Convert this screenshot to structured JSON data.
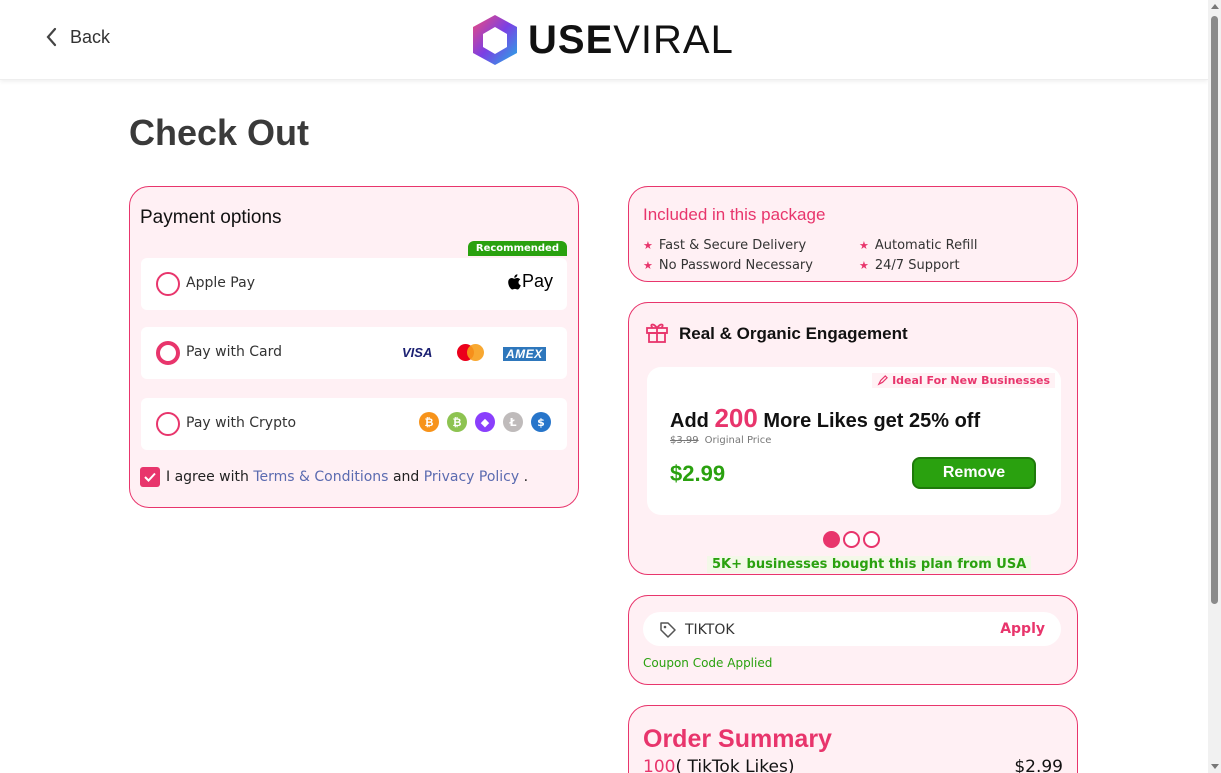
{
  "header": {
    "back_label": "Back",
    "logo_bold": "USE",
    "logo_light": "VIRAL"
  },
  "page_title": "Check Out",
  "payment": {
    "title": "Payment options",
    "recommended_badge": "Recommended",
    "options": [
      {
        "label": "Apple Pay",
        "selected": false,
        "brand": "Pay"
      },
      {
        "label": "Pay with Card",
        "selected": true,
        "brands": [
          "VISA",
          "AMEX"
        ]
      },
      {
        "label": "Pay with Crypto",
        "selected": false,
        "coins": [
          "bitcoin-icon",
          "bitcoin-cash-icon",
          "ethereum-icon",
          "litecoin-icon",
          "usdc-icon"
        ]
      }
    ],
    "agree_prefix": "I agree with",
    "terms_link": "Terms & Conditions",
    "agree_and": "and",
    "privacy_link": "Privacy Policy",
    "agree_suffix": ".",
    "agree_checked": true
  },
  "included": {
    "title": "Included in this package",
    "features": [
      "Fast & Secure Delivery",
      "Automatic Refill",
      "No Password Necessary",
      "24/7 Support"
    ]
  },
  "engagement": {
    "title": "Real & Organic Engagement",
    "ideal_tag": "Ideal For New Businesses",
    "add_prefix": "Add",
    "add_count": "200",
    "add_suffix": "More Likes get 25% off",
    "original_price": "$3.99",
    "original_label": "Original Price",
    "price": "$2.99",
    "remove_label": "Remove",
    "active_slide": 1,
    "slide_count": 3,
    "bought_note": "5K+ businesses bought this plan from USA"
  },
  "coupon": {
    "code": "TIKTOK",
    "apply_label": "Apply",
    "message": "Coupon Code Applied"
  },
  "summary": {
    "title": "Order Summary",
    "line_qty": "100",
    "line_label": "( TikTok Likes)",
    "line_price": "$2.99"
  },
  "colors": {
    "accent": "#e8356c",
    "green": "#2aa10f",
    "card_bg": "#fff0f4"
  }
}
